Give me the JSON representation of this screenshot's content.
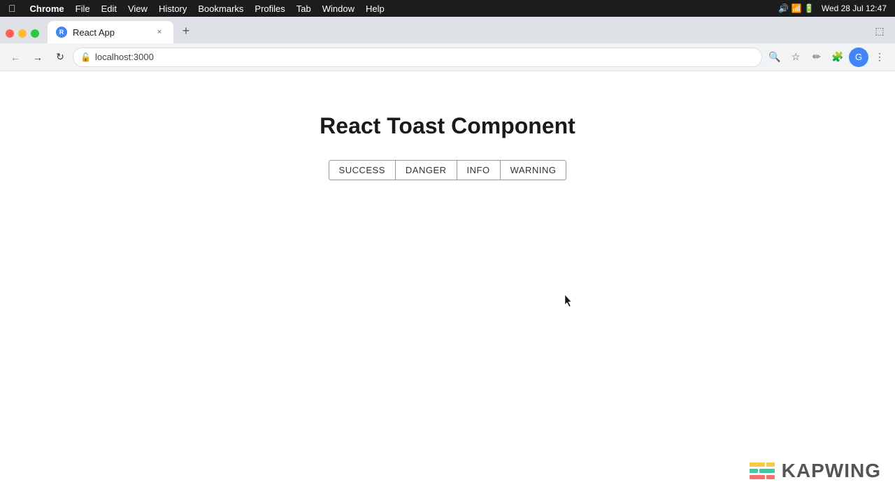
{
  "macos": {
    "menubar": {
      "apple": "",
      "items": [
        "Chrome",
        "File",
        "Edit",
        "View",
        "History",
        "Bookmarks",
        "Profiles",
        "Tab",
        "Window",
        "Help"
      ],
      "right": {
        "datetime": "Wed 28 Jul  12:47"
      }
    }
  },
  "browser": {
    "tab": {
      "label": "React App",
      "close": "×"
    },
    "new_tab": "+",
    "address": {
      "url": "localhost:3000"
    }
  },
  "page": {
    "title": "React Toast Component",
    "buttons": [
      {
        "label": "SUCCESS",
        "id": "success-button"
      },
      {
        "label": "DANGER",
        "id": "danger-button"
      },
      {
        "label": "INFO",
        "id": "info-button"
      },
      {
        "label": "WARNING",
        "id": "warning-button"
      }
    ]
  },
  "kapwing": {
    "text": "KAPWING"
  }
}
